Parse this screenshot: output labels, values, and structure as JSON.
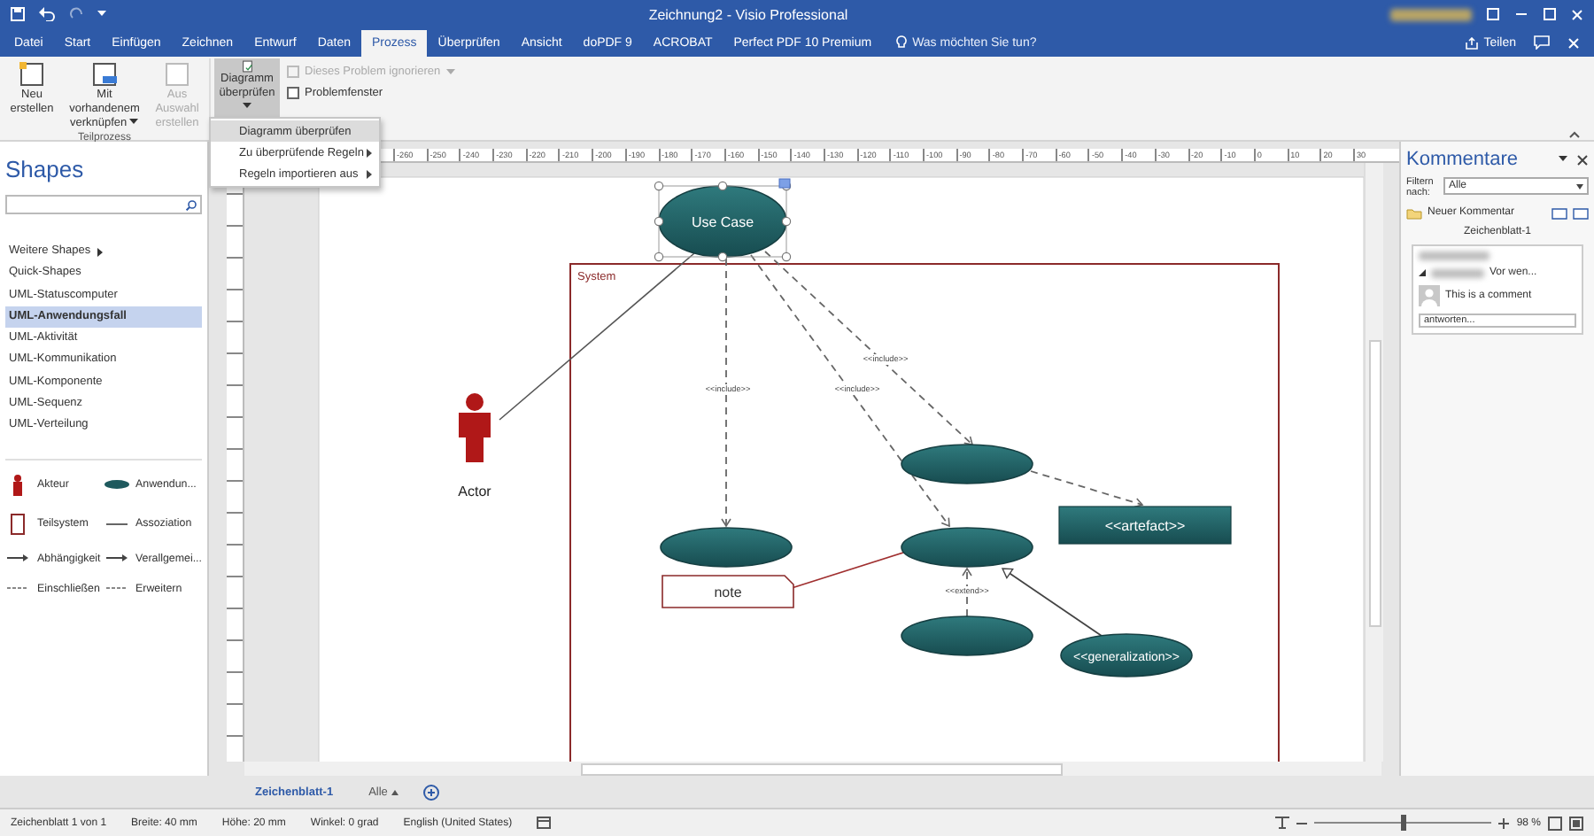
{
  "title_bar": {
    "title": "Zeichnung2 - Visio Professional"
  },
  "tabs": [
    {
      "label": "Datei",
      "selected": false
    },
    {
      "label": "Start",
      "selected": false
    },
    {
      "label": "Einfügen",
      "selected": false
    },
    {
      "label": "Zeichnen",
      "selected": false
    },
    {
      "label": "Entwurf",
      "selected": false
    },
    {
      "label": "Daten",
      "selected": false
    },
    {
      "label": "Prozess",
      "selected": true
    },
    {
      "label": "Überprüfen",
      "selected": false
    },
    {
      "label": "Ansicht",
      "selected": false
    },
    {
      "label": "doPDF 9",
      "selected": false
    },
    {
      "label": "ACROBAT",
      "selected": false
    },
    {
      "label": "Perfect PDF 10 Premium",
      "selected": false
    }
  ],
  "tell_me": {
    "placeholder": "Was möchten Sie tun?"
  },
  "share_button": "Teilen",
  "ribbon": {
    "subprocess_buttons": [
      {
        "label": "Neu erstellen",
        "disabled": false,
        "dropdown": false
      },
      {
        "label": "Mit vorhandenem verknüpfen",
        "disabled": false,
        "dropdown": true
      },
      {
        "label": "Aus Auswahl erstellen",
        "disabled": true,
        "dropdown": false
      }
    ],
    "group_label": "Teilprozess",
    "validate_button": {
      "label": "Diagramm überprüfen",
      "pressed": true
    },
    "ignore_button": {
      "label": "Dieses Problem ignorieren",
      "disabled": true
    },
    "problem_window": {
      "label": "Problemfenster",
      "checked": false
    }
  },
  "menu": {
    "items": [
      {
        "label": "Diagramm überprüfen",
        "selected": true,
        "submenu": false
      },
      {
        "label": "Zu überprüfende Regeln",
        "selected": false,
        "submenu": true
      },
      {
        "label": "Regeln importieren aus",
        "selected": false,
        "submenu": true
      }
    ]
  },
  "shapes_panel": {
    "title": "Shapes",
    "stencils": [
      {
        "label": "Weitere Shapes",
        "selected": false,
        "submenu": true
      },
      {
        "label": "Quick-Shapes",
        "selected": false,
        "submenu": false
      },
      {
        "label": "UML-Statuscomputer",
        "selected": false,
        "submenu": false
      },
      {
        "label": "UML-Anwendungsfall",
        "selected": true,
        "submenu": false
      },
      {
        "label": "UML-Aktivität",
        "selected": false,
        "submenu": false
      },
      {
        "label": "UML-Kommunikation",
        "selected": false,
        "submenu": false
      },
      {
        "label": "UML-Komponente",
        "selected": false,
        "submenu": false
      },
      {
        "label": "UML-Sequenz",
        "selected": false,
        "submenu": false
      },
      {
        "label": "UML-Verteilung",
        "selected": false,
        "submenu": false
      }
    ],
    "shapes": [
      {
        "label": "Akteur",
        "kind": "actor"
      },
      {
        "label": "Anwendun...",
        "kind": "use_case"
      },
      {
        "label": "Teilsystem",
        "kind": "subsystem"
      },
      {
        "label": "Assoziation",
        "kind": "line"
      },
      {
        "label": "Abhängigkeit",
        "kind": "arrow"
      },
      {
        "label": "Verallgemei...",
        "kind": "arrow"
      },
      {
        "label": "Einschließen",
        "kind": "dashed"
      },
      {
        "label": "Erweitern",
        "kind": "dashed"
      }
    ]
  },
  "ruler": {
    "horizontal": [
      "-260",
      "-250",
      "-240",
      "-230",
      "-220",
      "-210",
      "-200",
      "-190",
      "-180",
      "-170",
      "-160",
      "-150",
      "-140",
      "-130",
      "-120",
      "-110",
      "-100",
      "-90",
      "-80",
      "-70",
      "-60",
      "-50",
      "-40",
      "-30",
      "-20",
      "-10",
      "0",
      "10",
      "20",
      "30"
    ]
  },
  "diagram": {
    "system": {
      "label": "System"
    },
    "nodes": [
      {
        "kind": "use_case",
        "text": "Use Case",
        "selected": true
      },
      {
        "kind": "actor",
        "text": "Actor",
        "selected": false
      },
      {
        "kind": "use_case",
        "selected": false
      },
      {
        "kind": "use_case",
        "selected": false
      },
      {
        "kind": "use_case",
        "selected": false
      },
      {
        "kind": "use_case",
        "selected": false
      },
      {
        "kind": "artefact",
        "text": "<<artefact>>",
        "selected": false
      },
      {
        "kind": "use_case",
        "text": "<<generalization>>",
        "selected": false
      },
      {
        "kind": "note",
        "text": "note",
        "selected": false
      }
    ],
    "edges": [
      {
        "kind": "association"
      },
      {
        "kind": "include",
        "label": "<<include>>"
      },
      {
        "kind": "include",
        "label": "<<include>>"
      },
      {
        "kind": "include",
        "label": "<<include>>"
      },
      {
        "kind": "dependency"
      },
      {
        "kind": "extend",
        "label": "<<extend>>"
      },
      {
        "kind": "generalization"
      },
      {
        "kind": "note_link"
      }
    ]
  },
  "comments": {
    "title": "Kommentare",
    "filter_label": "Filtern nach:",
    "filter_value": "Alle",
    "new_comment": "Neuer Kommentar",
    "sheet": "Zeichenblatt-1",
    "thread": {
      "time": "Vor wen...",
      "text": "This is a comment",
      "reply_placeholder": "antworten..."
    }
  },
  "sheet_tabs": {
    "tab": "Zeichenblatt-1",
    "all_button": "Alle"
  },
  "status_bar": {
    "items": [
      "Zeichenblatt 1 von 1",
      "Breite: 40 mm",
      "Höhe: 20 mm",
      "Winkel: 0 grad",
      "English (United States)"
    ],
    "zoom": {
      "level": 0.5,
      "reading": "98 %"
    }
  }
}
